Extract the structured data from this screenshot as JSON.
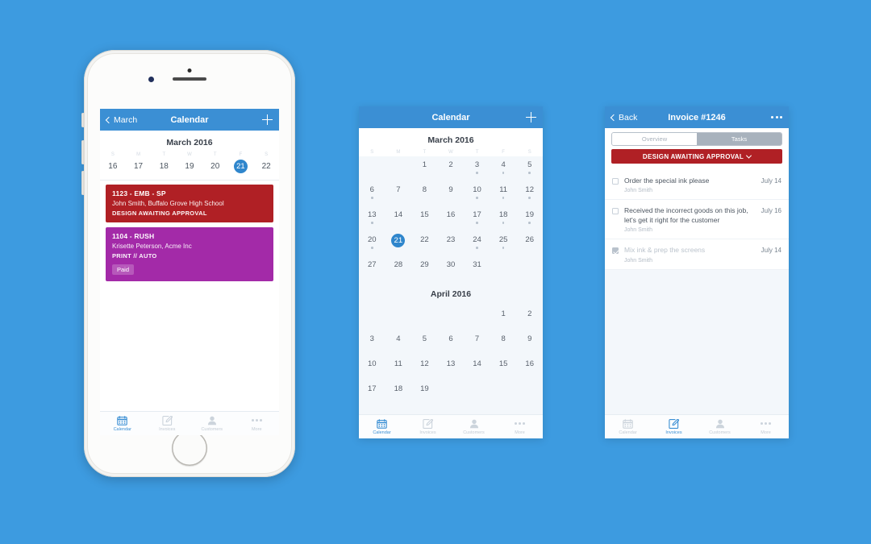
{
  "background_color": "#3d9be0",
  "accent_blue": "#3b8fd4",
  "phone1": {
    "navbar": {
      "back_label": "March",
      "title": "Calendar",
      "add_icon": "plus-icon"
    },
    "month_title": "March 2016",
    "weekday_letters": [
      "S",
      "M",
      "T",
      "W",
      "T",
      "F",
      "S"
    ],
    "week_days": [
      "16",
      "17",
      "18",
      "19",
      "20",
      "21",
      "22"
    ],
    "selected_day": "21",
    "events": [
      {
        "title": "1123 - EMB - SP",
        "subtitle": "John Smith, Buffalo Grove High School",
        "meta": "DESIGN AWAITING APPROVAL",
        "color": "#b02025",
        "badge": null
      },
      {
        "title": "1104 - RUSH",
        "subtitle": "Krisette Peterson, Acme Inc",
        "meta": "PRINT // AUTO",
        "color": "#a32aa8",
        "badge": "Paid"
      }
    ],
    "tabs": [
      {
        "label": "Calendar",
        "icon": "calendar-icon",
        "active": true
      },
      {
        "label": "Invoices",
        "icon": "invoice-pencil-icon",
        "active": false
      },
      {
        "label": "Customers",
        "icon": "person-icon",
        "active": false
      },
      {
        "label": "More",
        "icon": "ellipsis-icon",
        "active": false
      }
    ]
  },
  "phone2": {
    "navbar": {
      "title": "Calendar",
      "add_icon": "plus-icon"
    },
    "weekday_letters": [
      "S",
      "M",
      "T",
      "W",
      "T",
      "F",
      "S"
    ],
    "months": [
      {
        "title": "March 2016",
        "lead_blanks": 2,
        "days": [
          {
            "n": "1",
            "dot": false
          },
          {
            "n": "2",
            "dot": false
          },
          {
            "n": "3",
            "dot": true
          },
          {
            "n": "4",
            "dot": true
          },
          {
            "n": "5",
            "dot": true
          },
          {
            "n": "6",
            "dot": true
          },
          {
            "n": "7",
            "dot": false
          },
          {
            "n": "8",
            "dot": false
          },
          {
            "n": "9",
            "dot": false
          },
          {
            "n": "10",
            "dot": true
          },
          {
            "n": "11",
            "dot": true
          },
          {
            "n": "12",
            "dot": true
          },
          {
            "n": "13",
            "dot": true
          },
          {
            "n": "14",
            "dot": false
          },
          {
            "n": "15",
            "dot": false
          },
          {
            "n": "16",
            "dot": false
          },
          {
            "n": "17",
            "dot": true
          },
          {
            "n": "18",
            "dot": true
          },
          {
            "n": "19",
            "dot": true
          },
          {
            "n": "20",
            "dot": true
          },
          {
            "n": "21",
            "dot": false,
            "today": true
          },
          {
            "n": "22",
            "dot": false
          },
          {
            "n": "23",
            "dot": false
          },
          {
            "n": "24",
            "dot": true
          },
          {
            "n": "25",
            "dot": true
          },
          {
            "n": "26",
            "dot": false
          },
          {
            "n": "27",
            "dot": false
          },
          {
            "n": "28",
            "dot": false
          },
          {
            "n": "29",
            "dot": false
          },
          {
            "n": "30",
            "dot": false
          },
          {
            "n": "31",
            "dot": false
          }
        ]
      },
      {
        "title": "April 2016",
        "lead_blanks": 5,
        "days": [
          {
            "n": "1",
            "dot": false
          },
          {
            "n": "2",
            "dot": false
          },
          {
            "n": "3",
            "dot": false
          },
          {
            "n": "4",
            "dot": false
          },
          {
            "n": "5",
            "dot": false
          },
          {
            "n": "6",
            "dot": false
          },
          {
            "n": "7",
            "dot": false
          },
          {
            "n": "8",
            "dot": false
          },
          {
            "n": "9",
            "dot": false
          },
          {
            "n": "10",
            "dot": false
          },
          {
            "n": "11",
            "dot": false
          },
          {
            "n": "12",
            "dot": false
          },
          {
            "n": "13",
            "dot": false
          },
          {
            "n": "14",
            "dot": false
          },
          {
            "n": "15",
            "dot": false
          },
          {
            "n": "16",
            "dot": false
          },
          {
            "n": "17",
            "dot": false
          },
          {
            "n": "18",
            "dot": false
          },
          {
            "n": "19",
            "dot": false
          }
        ]
      }
    ],
    "tabs": [
      {
        "label": "Calendar",
        "icon": "calendar-icon",
        "active": true
      },
      {
        "label": "Invoices",
        "icon": "invoice-pencil-icon",
        "active": false
      },
      {
        "label": "Customers",
        "icon": "person-icon",
        "active": false
      },
      {
        "label": "More",
        "icon": "ellipsis-icon",
        "active": false
      }
    ]
  },
  "phone3": {
    "navbar": {
      "back_label": "Back",
      "title": "Invoice #1246",
      "more_icon": "ellipsis-icon"
    },
    "segments": [
      {
        "label": "Overview",
        "active": false
      },
      {
        "label": "Tasks",
        "active": true
      }
    ],
    "status": {
      "label": "DESIGN AWAITING APPROVAL",
      "color": "#b02025",
      "chevron": "chevron-down-icon"
    },
    "tasks": [
      {
        "text": "Order the special ink please",
        "assignee": "John Smith",
        "date": "July 14",
        "done": false
      },
      {
        "text": "Received the incorrect goods on this job, let's get it right for the customer",
        "assignee": "John Smith",
        "date": "July 16",
        "done": false
      },
      {
        "text": "Mix ink & prep the screens",
        "assignee": "John Smith",
        "date": "July 14",
        "done": true
      }
    ],
    "tabs": [
      {
        "label": "Calendar",
        "icon": "calendar-icon",
        "active": false
      },
      {
        "label": "Invoices",
        "icon": "invoice-pencil-icon",
        "active": true
      },
      {
        "label": "Customers",
        "icon": "person-icon",
        "active": false
      },
      {
        "label": "More",
        "icon": "ellipsis-icon",
        "active": false
      }
    ]
  }
}
